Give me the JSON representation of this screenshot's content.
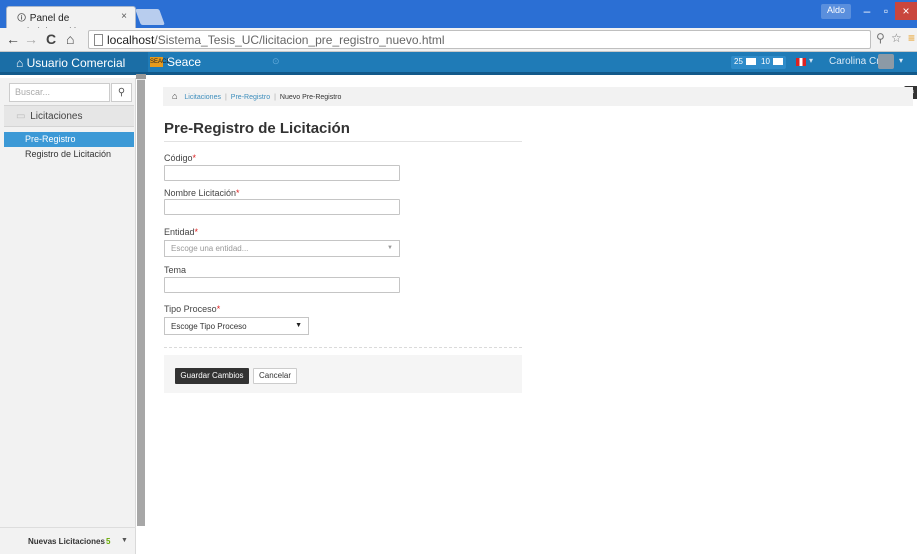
{
  "browser": {
    "tab_title": "Panel de Administración",
    "tab_close": "×",
    "user_chip": "Aldo",
    "win_min": "–",
    "win_max": "▫",
    "win_close": "×",
    "url_host": "localhost",
    "url_path": "/Sistema_Tesis_UC/licitacion_pre_registro_nuevo.html",
    "icons": [
      "back-icon",
      "forward-icon",
      "reload-icon",
      "home-icon",
      "page-icon",
      "zoom-icon",
      "star-icon",
      "menu-icon"
    ]
  },
  "header": {
    "user_section": "Usuario Comercial",
    "logo_text": "SEACE",
    "brand": "Seace",
    "dot": "⊙",
    "badge1_count": "25",
    "badge2_count": "10",
    "user_name": "Carolina Cruz",
    "colors": {
      "header_bg": "#1f7bb7",
      "logo": "#e89a1b",
      "active": "#3c99d6"
    }
  },
  "sidebar": {
    "search_placeholder": "Buscar...",
    "section": "Licitaciones",
    "items": [
      {
        "label": "Pre-Registro",
        "active": true
      },
      {
        "label": "Registro de Licitación",
        "active": false
      }
    ],
    "footer_label": "Nuevas Licitaciones",
    "footer_count": "5"
  },
  "breadcrumb": {
    "items": [
      "Licitaciones",
      "Pre-Registro"
    ],
    "current": "Nuevo Pre-Registro"
  },
  "page": {
    "title": "Pre-Registro de Licitación"
  },
  "form": {
    "codigo_label": "Código",
    "nombre_label": "Nombre Licitación",
    "entidad_label": "Entidad",
    "entidad_placeholder": "Escoge una entidad...",
    "tema_label": "Tema",
    "tipo_label": "Tipo Proceso",
    "tipo_selected": "Escoge Tipo Proceso",
    "required_mark": "*"
  },
  "actions": {
    "save": "Guardar Cambios",
    "cancel": "Cancelar"
  }
}
